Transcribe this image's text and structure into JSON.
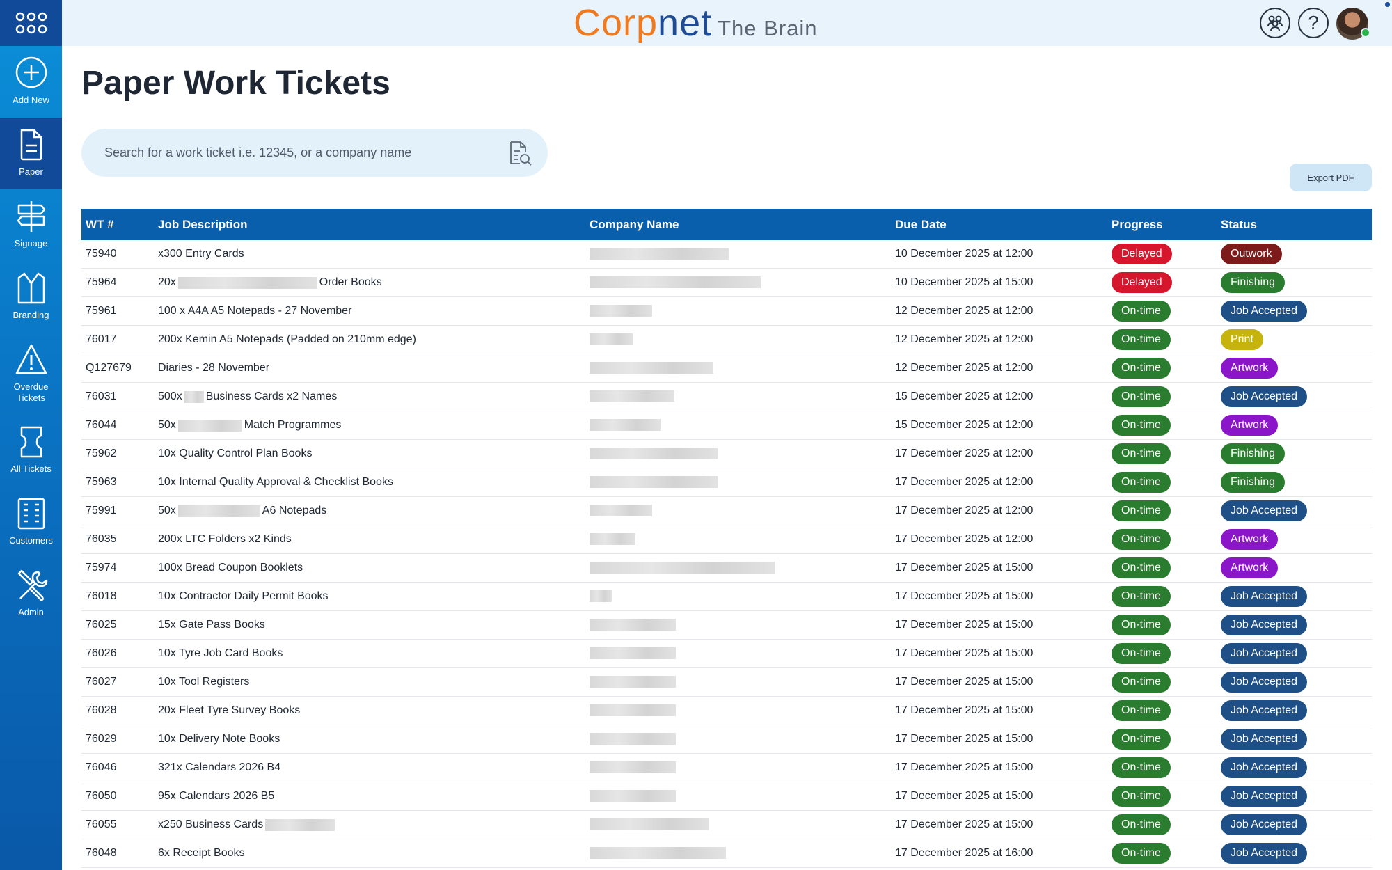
{
  "header": {
    "logo_corp": "Corp",
    "logo_net": "net",
    "logo_brain": "The Brain"
  },
  "sidebar": {
    "items": [
      {
        "label": "Add New",
        "icon": "plus-circle-icon"
      },
      {
        "label": "Paper",
        "icon": "document-icon",
        "active": true
      },
      {
        "label": "Signage",
        "icon": "signpost-icon"
      },
      {
        "label": "Branding",
        "icon": "vest-icon"
      },
      {
        "label": "Overdue Tickets",
        "icon": "warning-icon"
      },
      {
        "label": "All Tickets",
        "icon": "ticket-icon"
      },
      {
        "label": "Customers",
        "icon": "building-icon"
      },
      {
        "label": "Admin",
        "icon": "tools-icon"
      }
    ]
  },
  "page": {
    "title": "Paper Work Tickets",
    "search_placeholder": "Search for a work ticket i.e. 12345, or a company name",
    "export_label": "Export PDF"
  },
  "table": {
    "columns": [
      "WT #",
      "Job Description",
      "Company Name",
      "Due Date",
      "Progress",
      "Status"
    ],
    "rows": [
      {
        "wt": "75940",
        "job": "x300 Entry Cards",
        "due": "10 December 2025 at 12:00",
        "progress": "Delayed",
        "status": "Outwork"
      },
      {
        "wt": "75964",
        "job_pre": "20x",
        "job_post": "Order Books",
        "due": "10 December 2025 at 15:00",
        "progress": "Delayed",
        "status": "Finishing"
      },
      {
        "wt": "75961",
        "job": "100 x A4A A5 Notepads - 27 November",
        "due": "12 December 2025 at 12:00",
        "progress": "On-time",
        "status": "Job Accepted"
      },
      {
        "wt": "76017",
        "job": "200x Kemin A5 Notepads (Padded on 210mm edge)",
        "due": "12 December 2025 at 12:00",
        "progress": "On-time",
        "status": "Print"
      },
      {
        "wt": "Q127679",
        "job": "Diaries - 28 November",
        "due": "12 December 2025 at 12:00",
        "progress": "On-time",
        "status": "Artwork"
      },
      {
        "wt": "76031",
        "job_pre": "500x",
        "job_post": "Business Cards x2 Names",
        "due": "15 December 2025 at 12:00",
        "progress": "On-time",
        "status": "Job Accepted"
      },
      {
        "wt": "76044",
        "job_pre": "50x",
        "job_post": "Match Programmes",
        "due": "15 December 2025 at 12:00",
        "progress": "On-time",
        "status": "Artwork"
      },
      {
        "wt": "75962",
        "job": "10x Quality Control Plan Books",
        "due": "17 December 2025 at 12:00",
        "progress": "On-time",
        "status": "Finishing"
      },
      {
        "wt": "75963",
        "job": "10x Internal Quality Approval & Checklist Books",
        "due": "17 December 2025 at 12:00",
        "progress": "On-time",
        "status": "Finishing"
      },
      {
        "wt": "75991",
        "job_pre": "50x",
        "job_post": "A6 Notepads",
        "due": "17 December 2025 at 12:00",
        "progress": "On-time",
        "status": "Job Accepted"
      },
      {
        "wt": "76035",
        "job": "200x LTC Folders x2 Kinds",
        "due": "17 December 2025 at 12:00",
        "progress": "On-time",
        "status": "Artwork"
      },
      {
        "wt": "75974",
        "job": "100x Bread Coupon Booklets",
        "due": "17 December 2025 at 15:00",
        "progress": "On-time",
        "status": "Artwork"
      },
      {
        "wt": "76018",
        "job": "10x Contractor Daily Permit Books",
        "due": "17 December 2025 at 15:00",
        "progress": "On-time",
        "status": "Job Accepted"
      },
      {
        "wt": "76025",
        "job": "15x Gate Pass Books",
        "due": "17 December 2025 at 15:00",
        "progress": "On-time",
        "status": "Job Accepted"
      },
      {
        "wt": "76026",
        "job": "10x Tyre Job Card Books",
        "due": "17 December 2025 at 15:00",
        "progress": "On-time",
        "status": "Job Accepted"
      },
      {
        "wt": "76027",
        "job": "10x Tool Registers",
        "due": "17 December 2025 at 15:00",
        "progress": "On-time",
        "status": "Job Accepted"
      },
      {
        "wt": "76028",
        "job": "20x Fleet Tyre Survey Books",
        "due": "17 December 2025 at 15:00",
        "progress": "On-time",
        "status": "Job Accepted"
      },
      {
        "wt": "76029",
        "job": "10x Delivery Note Books",
        "due": "17 December 2025 at 15:00",
        "progress": "On-time",
        "status": "Job Accepted"
      },
      {
        "wt": "76046",
        "job": "321x Calendars 2026 B4",
        "due": "17 December 2025 at 15:00",
        "progress": "On-time",
        "status": "Job Accepted"
      },
      {
        "wt": "76050",
        "job": "95x Calendars 2026 B5",
        "due": "17 December 2025 at 15:00",
        "progress": "On-time",
        "status": "Job Accepted"
      },
      {
        "wt": "76055",
        "job_pre": "x250 Business Cards",
        "job_post": "",
        "due": "17 December 2025 at 15:00",
        "progress": "On-time",
        "status": "Job Accepted"
      },
      {
        "wt": "76048",
        "job": "6x Receipt Books",
        "due": "17 December 2025 at 16:00",
        "progress": "On-time",
        "status": "Job Accepted"
      }
    ]
  },
  "colors": {
    "sidebar_top": "#0b8fd8",
    "sidebar_active": "#124a9a",
    "table_header": "#0a5fad",
    "delayed": "#d6162c",
    "on_time": "#2a7d2e",
    "outwork": "#7d1b1b",
    "finishing": "#2a7d2e",
    "job_accepted": "#1e4f86",
    "print": "#c7b30e",
    "artwork": "#8b16c9"
  }
}
